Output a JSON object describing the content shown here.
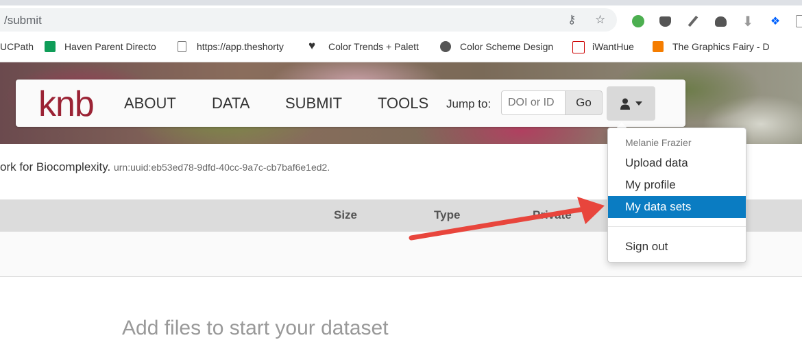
{
  "browser": {
    "url": "/submit",
    "bookmarks": [
      "UCPath",
      "Haven Parent Directo",
      "https://app.theshorty",
      "Color Trends + Palett",
      "Color Scheme Design",
      "iWantHue",
      "The Graphics Fairy - D"
    ]
  },
  "nav": {
    "logo": "knb",
    "links": [
      "ABOUT",
      "DATA",
      "SUBMIT",
      "TOOLS"
    ],
    "jump_label": "Jump to:",
    "search_placeholder": "DOI or ID",
    "go_label": "Go"
  },
  "page": {
    "subtitle_text": "ork for Biocomplexity.",
    "urn": "urn:uuid:eb53ed78-9dfd-40cc-9a7c-cb7baf6e1ed2.",
    "columns": [
      "Size",
      "Type",
      "Private"
    ],
    "add_files": "Add files to start your dataset"
  },
  "user_menu": {
    "user_name": "Melanie Frazier",
    "items": [
      "Upload data",
      "My profile",
      "My data sets",
      "Sign out"
    ],
    "active_item": "My data sets"
  },
  "colors": {
    "accent": "#0a7cc2",
    "logo": "#9b2335",
    "annotation_arrow": "#e8453c"
  }
}
